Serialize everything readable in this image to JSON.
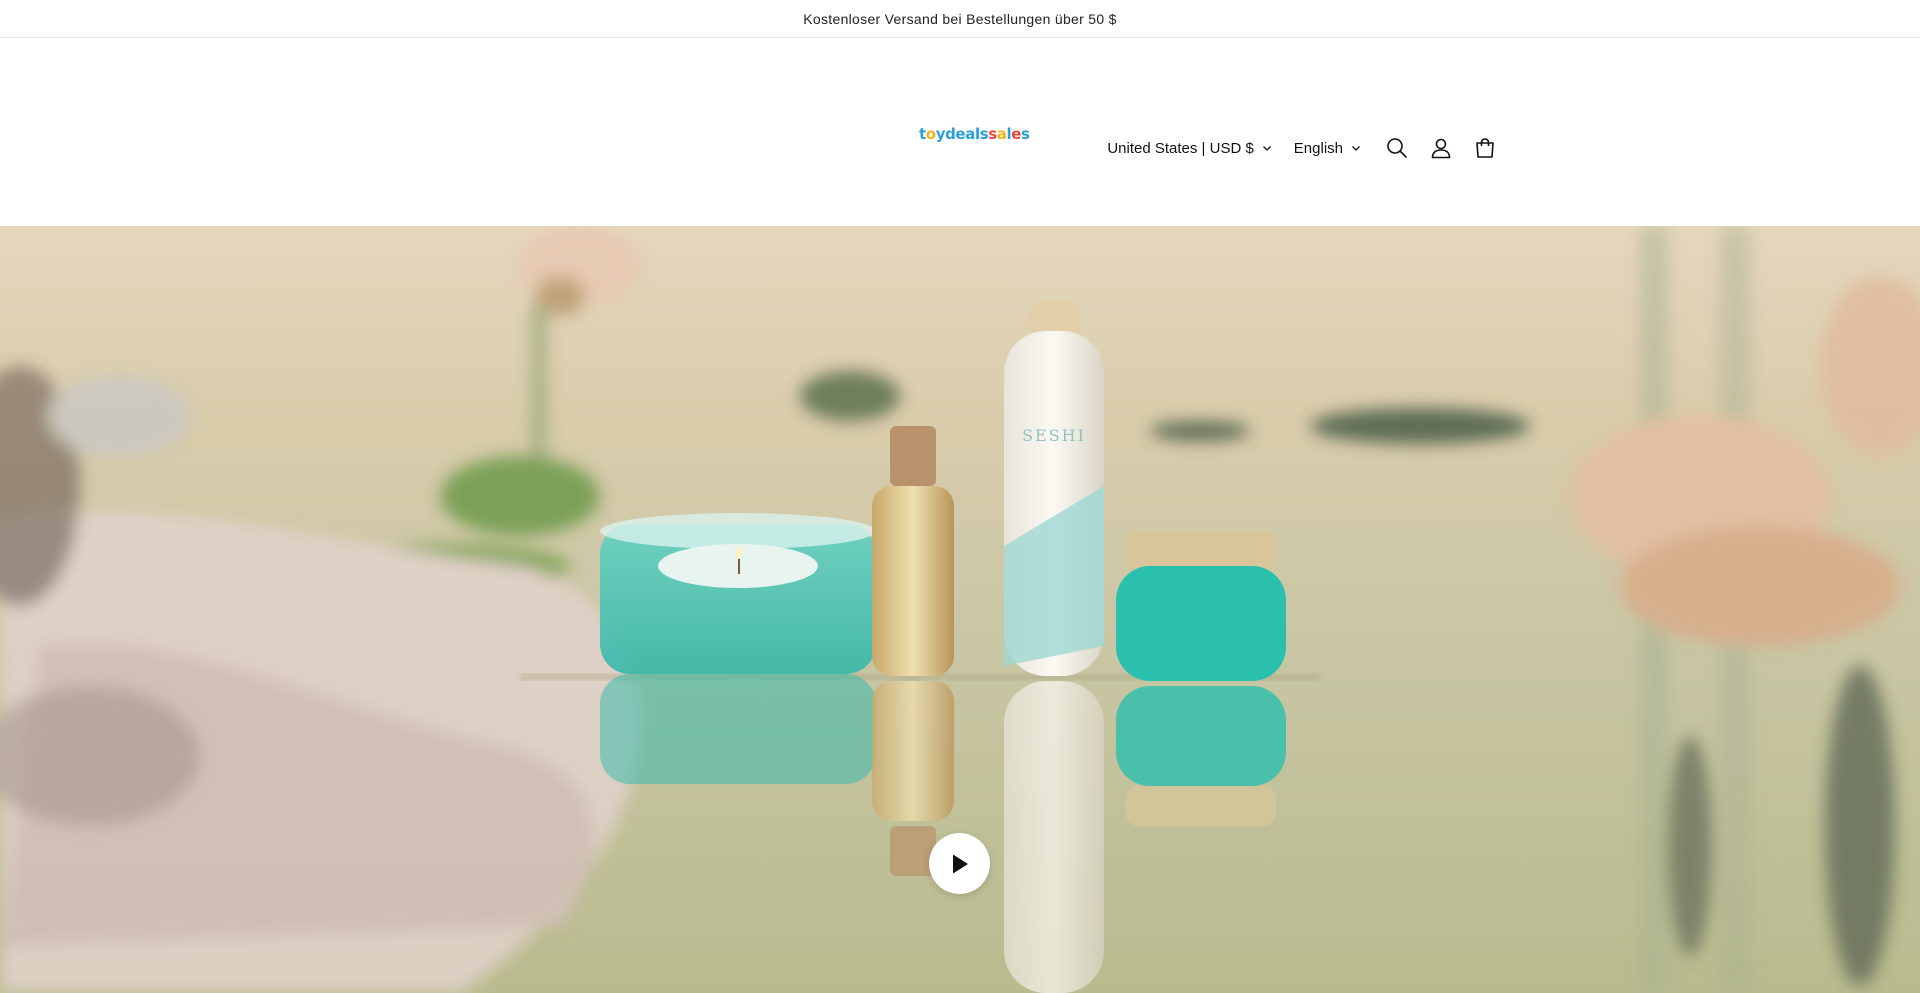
{
  "announcement": {
    "text": "Kostenloser Versand bei Bestellungen über 50 $"
  },
  "logo": {
    "letters": [
      {
        "ch": "t",
        "color": "#2a9fd8"
      },
      {
        "ch": "o",
        "color": "#f2b21a"
      },
      {
        "ch": "y",
        "color": "#2a9fd8"
      },
      {
        "ch": "d",
        "color": "#2a9fd8"
      },
      {
        "ch": "e",
        "color": "#2a9fd8"
      },
      {
        "ch": "a",
        "color": "#2a9fd8"
      },
      {
        "ch": "l",
        "color": "#2a9fd8"
      },
      {
        "ch": "s",
        "color": "#2a9fd8"
      },
      {
        "ch": "s",
        "color": "#e8483a"
      },
      {
        "ch": "a",
        "color": "#f2b21a"
      },
      {
        "ch": "l",
        "color": "#2a9fd8"
      },
      {
        "ch": "e",
        "color": "#e8483a"
      },
      {
        "ch": "s",
        "color": "#2a9fd8"
      }
    ]
  },
  "header": {
    "country_selector": "United States | USD $",
    "language_selector": "English",
    "icons": [
      "search-icon",
      "account-icon",
      "cart-icon"
    ]
  },
  "hero": {
    "video": {
      "play_icon": "play-icon"
    }
  }
}
